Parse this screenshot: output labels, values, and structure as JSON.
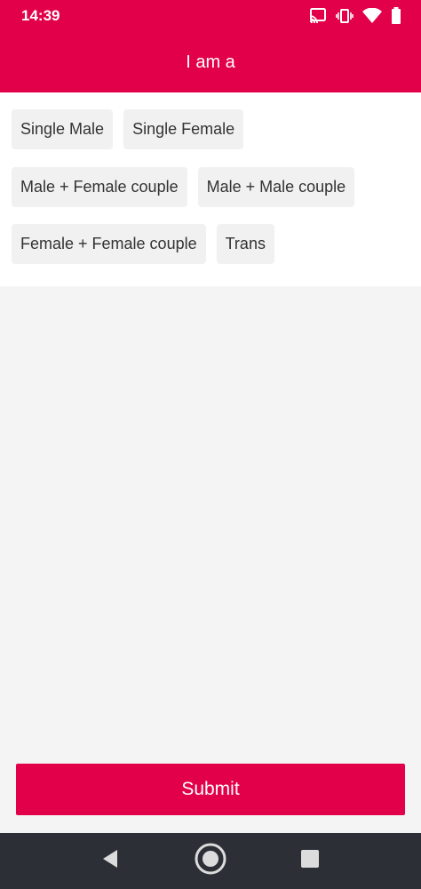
{
  "status_bar": {
    "time": "14:39",
    "icons": [
      "cast-icon",
      "vibrate-icon",
      "wifi-icon",
      "battery-icon"
    ]
  },
  "app_bar": {
    "title": "I am a"
  },
  "options": [
    [
      "Single Male",
      "Single Female"
    ],
    [
      "Male + Female couple",
      "Male + Male couple"
    ],
    [
      "Female + Female couple",
      "Trans"
    ]
  ],
  "submit": {
    "label": "Submit"
  },
  "nav_bar": {
    "icons": [
      "back-icon",
      "home-icon",
      "recents-icon"
    ]
  },
  "colors": {
    "accent": "#e2004a",
    "background": "#f4f4f4",
    "chip": "#f1f1f1",
    "nav": "#2c2f36"
  }
}
